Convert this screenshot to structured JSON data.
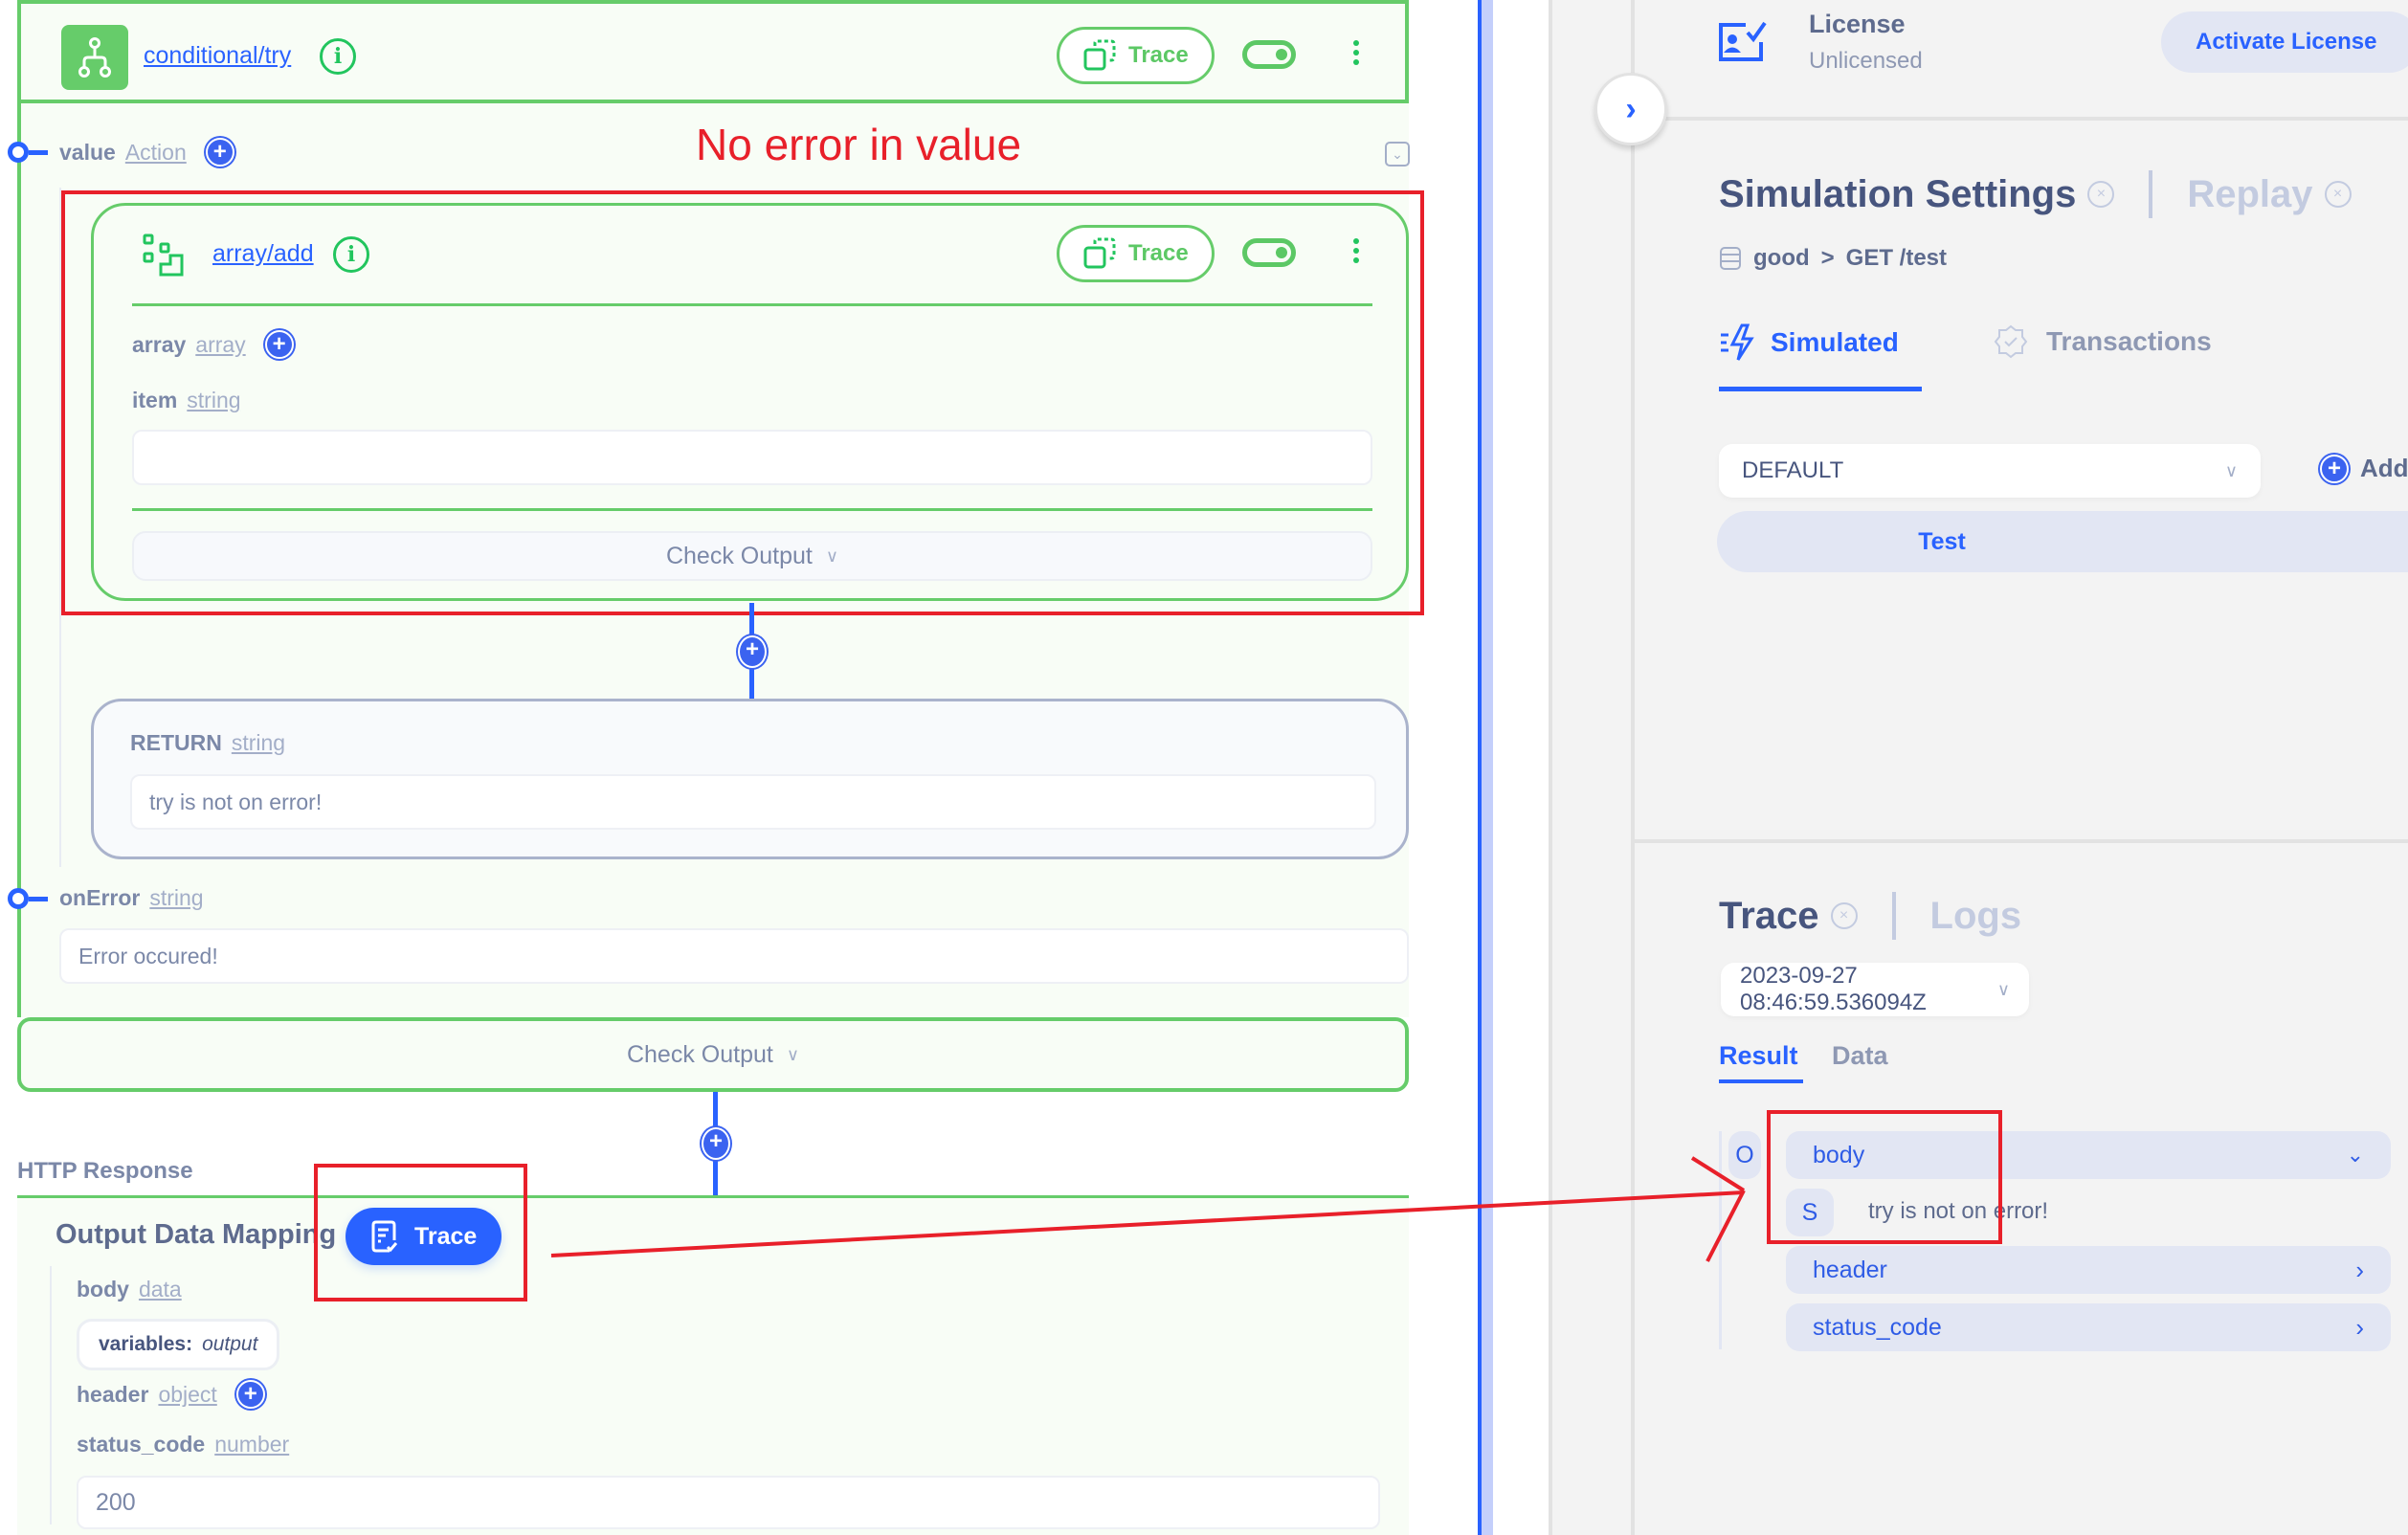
{
  "annotation": {
    "callout_text": "No error in value",
    "color": "#e8202a"
  },
  "flow": {
    "try_node": {
      "title": "conditional/try",
      "trace_label": "Trace"
    },
    "value_param": {
      "name": "value",
      "type": "Action"
    },
    "array_add_node": {
      "title": "array/add",
      "trace_label": "Trace",
      "params": [
        {
          "name": "array",
          "type": "array"
        },
        {
          "name": "item",
          "type": "string"
        }
      ],
      "item_value": "",
      "check_output_label": "Check Output"
    },
    "return_node": {
      "label": "RETURN",
      "type": "string",
      "value": "try is not on error!"
    },
    "on_error_param": {
      "name": "onError",
      "type": "string",
      "value": "Error occured!"
    },
    "check_output_label": "Check Output",
    "http_response": {
      "section_label": "HTTP Response",
      "mapping_title": "Output Data Mapping",
      "trace_label": "Trace",
      "fields": {
        "body": {
          "name": "body",
          "type": "data",
          "chip_key": "variables:",
          "chip_value": "output"
        },
        "header": {
          "name": "header",
          "type": "object"
        },
        "status_code": {
          "name": "status_code",
          "type": "number",
          "value": "200"
        }
      }
    }
  },
  "right_panel": {
    "license": {
      "title": "License",
      "status": "Unlicensed",
      "activate_label": "Activate License"
    },
    "simulation": {
      "title": "Simulation Settings",
      "alt_tab": "Replay",
      "breadcrumb": {
        "service": "good",
        "separator": ">",
        "route": "GET /test"
      },
      "tabs": [
        {
          "label": "Simulated",
          "active": true
        },
        {
          "label": "Transactions",
          "active": false
        }
      ],
      "scenario_select": "DEFAULT",
      "add_label": "Add",
      "test_label": "Test"
    },
    "trace": {
      "title": "Trace",
      "alt_tab": "Logs",
      "timestamp": "2023-09-27 08:46:59.536094Z",
      "subtabs": [
        {
          "label": "Result",
          "active": true
        },
        {
          "label": "Data",
          "active": false
        }
      ],
      "tree": {
        "root_badge": "O",
        "items": [
          {
            "key": "body",
            "expanded": true,
            "child_badge": "S",
            "child_value": "try is not on error!"
          },
          {
            "key": "header",
            "expanded": false
          },
          {
            "key": "status_code",
            "expanded": false
          }
        ]
      }
    }
  },
  "colors": {
    "accent_blue": "#2962ff",
    "node_green": "#66cc6a",
    "annotation_red": "#e8202a",
    "text_slate": "#47557e"
  }
}
